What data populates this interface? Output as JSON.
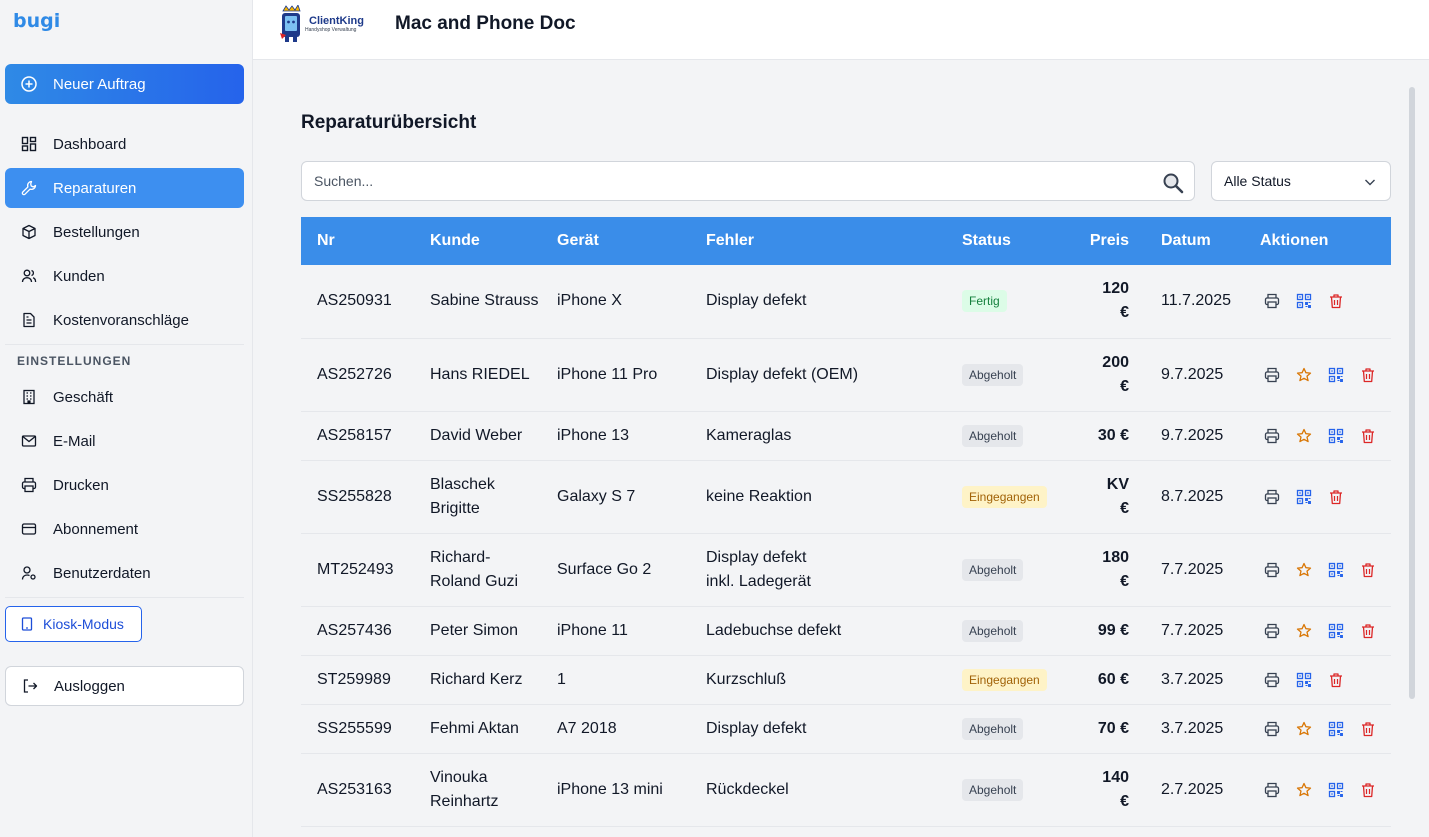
{
  "sidebar": {
    "brand": "bugi",
    "new_order": "Neuer Auftrag",
    "items": [
      {
        "label": "Dashboard"
      },
      {
        "label": "Reparaturen"
      },
      {
        "label": "Bestellungen"
      },
      {
        "label": "Kunden"
      },
      {
        "label": "Kostenvoranschläge"
      }
    ],
    "settings_label": "EINSTELLUNGEN",
    "settings_items": [
      {
        "label": "Geschäft"
      },
      {
        "label": "E-Mail"
      },
      {
        "label": "Drucken"
      },
      {
        "label": "Abonnement"
      },
      {
        "label": "Benutzerdaten"
      }
    ],
    "kiosk": "Kiosk-Modus",
    "logout": "Ausloggen"
  },
  "header": {
    "logo_text": "ClientKing",
    "logo_sub": "Handyshop Verwaltung",
    "shop_name": "Mac and Phone Doc"
  },
  "main": {
    "title": "Reparaturübersicht",
    "search_placeholder": "Suchen...",
    "status_filter": "Alle Status",
    "columns": {
      "nr": "Nr",
      "kunde": "Kunde",
      "geraet": "Gerät",
      "fehler": "Fehler",
      "status": "Status",
      "preis": "Preis",
      "datum": "Datum",
      "aktionen": "Aktionen"
    },
    "rows": [
      {
        "nr": "AS250931",
        "kunde": "Sabine Strauss",
        "geraet": "iPhone X",
        "fehler": "Display defekt",
        "status": "Fertig",
        "preis": "120 €",
        "datum": "11.7.2025"
      },
      {
        "nr": "AS252726",
        "kunde": "Hans RIEDEL",
        "geraet": "iPhone 11 Pro",
        "fehler": "Display defekt (OEM)",
        "status": "Abgeholt",
        "preis": "200 €",
        "datum": "9.7.2025"
      },
      {
        "nr": "AS258157",
        "kunde": "David Weber",
        "geraet": "iPhone 13",
        "fehler": "Kameraglas",
        "status": "Abgeholt",
        "preis": "30 €",
        "datum": "9.7.2025"
      },
      {
        "nr": "SS255828",
        "kunde": "Blaschek Brigitte",
        "geraet": "Galaxy S 7",
        "fehler": "keine Reaktion",
        "status": "Eingegangen",
        "preis": "KV €",
        "datum": "8.7.2025"
      },
      {
        "nr": "MT252493",
        "kunde": "Richard-Roland Guzi",
        "geraet": "Surface Go 2",
        "fehler": "Display defekt\n inkl. Ladegerät",
        "status": "Abgeholt",
        "preis": "180 €",
        "datum": "7.7.2025"
      },
      {
        "nr": "AS257436",
        "kunde": "Peter Simon",
        "geraet": "iPhone 11",
        "fehler": "Ladebuchse defekt",
        "status": "Abgeholt",
        "preis": "99 €",
        "datum": "7.7.2025"
      },
      {
        "nr": "ST259989",
        "kunde": "Richard Kerz",
        "geraet": "1",
        "fehler": "Kurzschluß",
        "status": "Eingegangen",
        "preis": "60 €",
        "datum": "3.7.2025"
      },
      {
        "nr": "SS255599",
        "kunde": "Fehmi Aktan",
        "geraet": "A7 2018",
        "fehler": "Display defekt",
        "status": "Abgeholt",
        "preis": "70 €",
        "datum": "3.7.2025"
      },
      {
        "nr": "AS253163",
        "kunde": "Vinouka Reinhartz",
        "geraet": "iPhone 13 mini",
        "fehler": "Rückdeckel",
        "status": "Abgeholt",
        "preis": "140 €",
        "datum": "2.7.2025"
      }
    ]
  },
  "colors": {
    "accent": "#3a8de9",
    "active_nav": "#3d8ff0",
    "badge_fertig": "#dcfce7",
    "badge_abgeholt": "#e5e7eb",
    "badge_eingegangen": "#fef3c7",
    "delete": "#dc2626",
    "star": "#d97706",
    "qr": "#2563eb"
  }
}
